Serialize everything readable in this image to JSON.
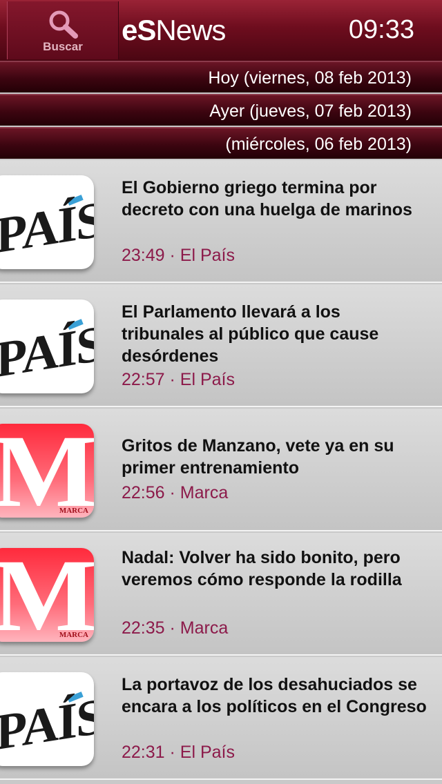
{
  "header": {
    "search_label": "Buscar",
    "brand_bold": "eS",
    "brand_regular": "News",
    "time": "09:33"
  },
  "days": [
    {
      "label": "Hoy (viernes, 08 feb 2013)"
    },
    {
      "label": "Ayer (jueves, 07 feb 2013)"
    },
    {
      "label": "(miércoles, 06 feb 2013)"
    }
  ],
  "logos": {
    "pais": "PAÍS",
    "marca": "M",
    "marca_small": "MARCA"
  },
  "news": [
    {
      "title": "El Gobierno griego termina por decreto con una huelga de marinos",
      "meta": "23:49 · El País",
      "source": "pais"
    },
    {
      "title": "El Parlamento llevará a los tribunales al público que cause desórdenes",
      "meta": "22:57 · El País",
      "source": "pais"
    },
    {
      "title": "Gritos de Manzano, vete ya en su primer entrenamiento",
      "meta": "22:56 · Marca",
      "source": "marca"
    },
    {
      "title": "Nadal: Volver ha sido bonito, pero veremos cómo responde la rodilla",
      "meta": "22:35 · Marca",
      "source": "marca"
    },
    {
      "title": "La portavoz de los desahuciados se encara a los políticos en el Congreso",
      "meta": "22:31 · El País",
      "source": "pais"
    }
  ]
}
